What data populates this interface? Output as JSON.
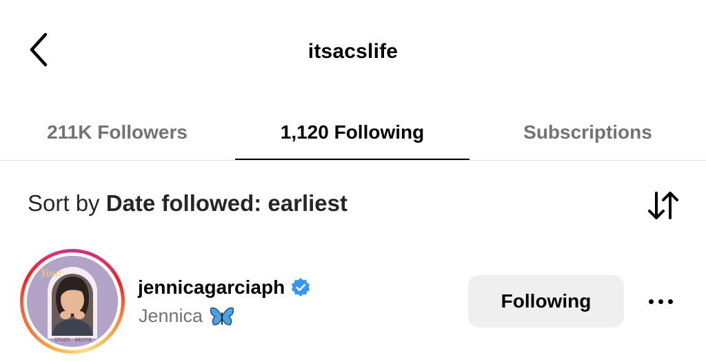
{
  "header": {
    "title": "itsacslife",
    "back_icon": "chevron-left-icon"
  },
  "tabs": [
    {
      "label": "211K Followers",
      "active": false
    },
    {
      "label": "1,120 Following",
      "active": true
    },
    {
      "label": "Subscriptions",
      "active": false
    }
  ],
  "sort": {
    "prefix": "Sort by",
    "value": "Date followed: earliest",
    "icon": "sort-arrows-icon"
  },
  "list": [
    {
      "username": "jennicagarciaph",
      "full_name": "Jennica",
      "verified": true,
      "emoji_icon": "butterfly-icon",
      "avatar_icon": "profile-photo",
      "button_label": "Following",
      "more_icon": "more-options-icon"
    }
  ],
  "colors": {
    "text_primary": "#000000",
    "text_secondary": "#737373",
    "button_bg": "#efefef",
    "verified_blue": "#3897f0",
    "divider": "#e2e2e2"
  }
}
